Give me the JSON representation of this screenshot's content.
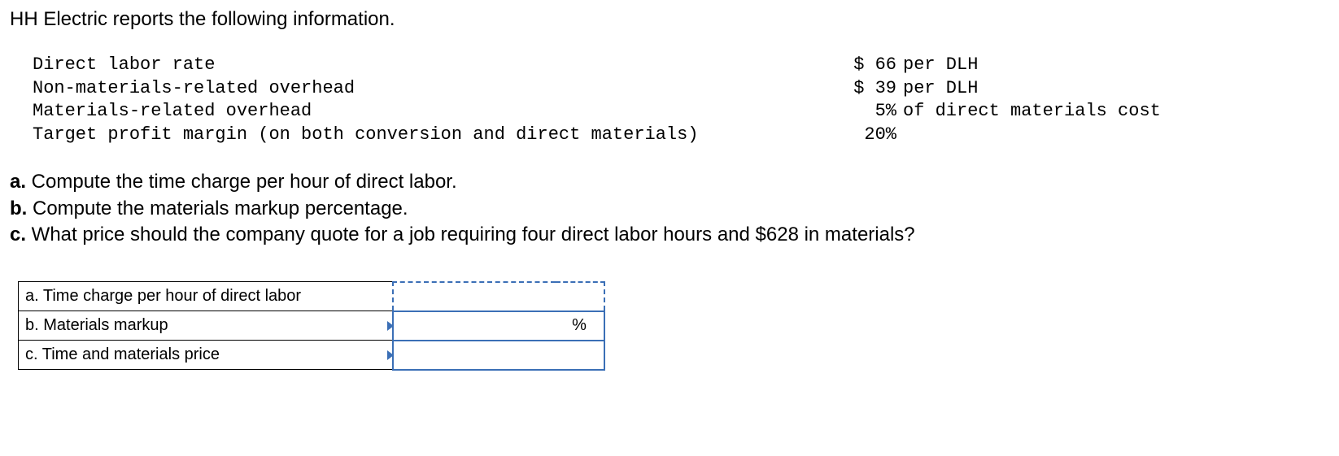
{
  "intro": "HH Electric reports the following information.",
  "data_rows": [
    {
      "label": "Direct labor rate",
      "value": "$ 66",
      "unit": "per DLH"
    },
    {
      "label": "Non-materials-related overhead",
      "value": "$ 39",
      "unit": "per DLH"
    },
    {
      "label": "Materials-related overhead",
      "value": "5%",
      "unit": "of direct materials cost"
    },
    {
      "label": "Target profit margin (on both conversion and direct materials)",
      "value": "20%",
      "unit": ""
    }
  ],
  "questions": {
    "a": {
      "letter": "a.",
      "text": " Compute the time charge per hour of direct labor."
    },
    "b": {
      "letter": "b.",
      "text": " Compute the materials markup percentage."
    },
    "c": {
      "letter": "c.",
      "text": " What price should the company quote for a job requiring four direct labor hours and $628 in materials?"
    }
  },
  "answer_table": {
    "a": {
      "label": "a. Time charge per hour of direct labor",
      "value": "",
      "unit": ""
    },
    "b": {
      "label": "b. Materials markup",
      "value": "",
      "unit": "%"
    },
    "c": {
      "label": "c. Time and materials price",
      "value": "",
      "unit": ""
    }
  }
}
